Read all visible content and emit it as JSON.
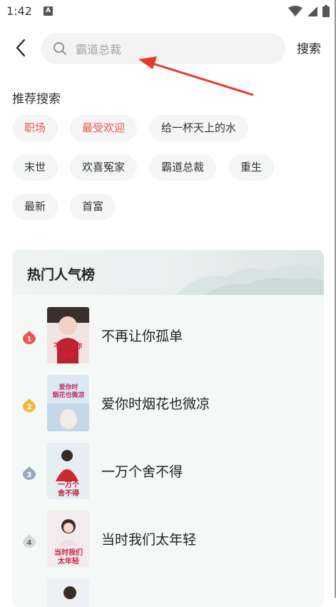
{
  "status": {
    "time": "1:42",
    "notif": "A"
  },
  "search": {
    "placeholder": "霸道总裁",
    "button": "搜索"
  },
  "recommend": {
    "title": "推荐搜索",
    "rows": [
      [
        {
          "label": "职场",
          "hot": true
        },
        {
          "label": "最受欢迎",
          "hot": true
        },
        {
          "label": "给一杯天上的水",
          "hot": false
        }
      ],
      [
        {
          "label": "末世",
          "hot": false
        },
        {
          "label": "欢喜冤家",
          "hot": false
        },
        {
          "label": "霸道总裁",
          "hot": false
        },
        {
          "label": "重生",
          "hot": false
        }
      ],
      [
        {
          "label": "最新",
          "hot": false
        },
        {
          "label": "首富",
          "hot": false
        }
      ]
    ]
  },
  "ranking": {
    "title": "热门人气榜",
    "items": [
      {
        "rank": "1",
        "title": "不再让你孤单",
        "cover_text": "不再让你孤单"
      },
      {
        "rank": "2",
        "title": "爱你时烟花也微凉",
        "cover_text": "爱你时烟花也微凉"
      },
      {
        "rank": "3",
        "title": "一万个舍不得",
        "cover_text": "一万个舍不得"
      },
      {
        "rank": "4",
        "title": "当时我们太年轻",
        "cover_text": "当时我们太年轻"
      }
    ]
  },
  "colors": {
    "accent": "#f0544a",
    "gold": "#f4b73a",
    "silver": "#9aaac2",
    "bronze": "#d7d7d7"
  }
}
